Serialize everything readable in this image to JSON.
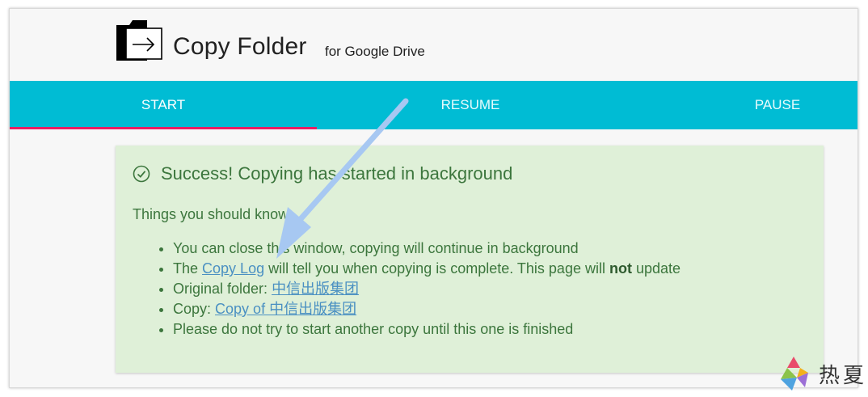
{
  "header": {
    "title": "Copy Folder",
    "subtitle": "for Google Drive"
  },
  "tabs": [
    {
      "label": "START",
      "active": true
    },
    {
      "label": "RESUME",
      "active": false
    },
    {
      "label": "PAUSE",
      "active": false
    }
  ],
  "alert": {
    "title": "Success! Copying has started in background",
    "intro": "Things you should know:",
    "items": {
      "close_window": "You can close this window, copying will continue in background",
      "log_prefix": "The ",
      "log_link": "Copy Log",
      "log_middle": " will tell you when copying is complete. This page will ",
      "log_bold": "not",
      "log_suffix": " update",
      "original_prefix": "Original folder: ",
      "original_link": "中信出版集团",
      "copy_prefix": "Copy: ",
      "copy_link": "Copy of 中信出版集团",
      "warning": "Please do not try to start another copy until this one is finished"
    }
  },
  "watermark": {
    "text": "热夏"
  },
  "colors": {
    "tab_bar": "#00bcd4",
    "tab_indicator": "#e91e63",
    "alert_bg": "#dff0d8",
    "alert_text": "#3c763d",
    "link": "#4a90c2",
    "annotation_arrow": "#a7c8f2"
  },
  "icons": {
    "logo": "folder-copy-icon",
    "success": "check-circle-icon"
  }
}
